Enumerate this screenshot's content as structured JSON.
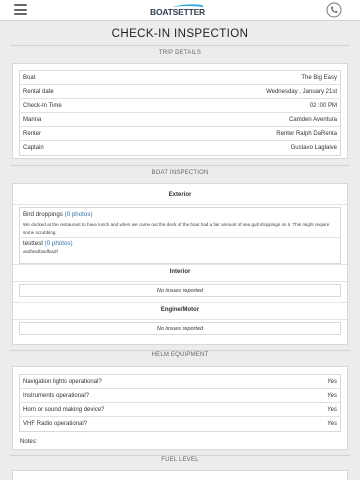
{
  "header": {
    "logo_text": "BOATSETTER",
    "menu_icon": "hamburger-menu-icon",
    "phone_icon": "phone-icon"
  },
  "page_title": "CHECK-IN INSPECTION",
  "trip_details": {
    "heading": "TRIP DETAILS",
    "rows": [
      {
        "label": "Boat",
        "value": "The Big Easy"
      },
      {
        "label": "Rental date",
        "value": "Wednesday , January 21st"
      },
      {
        "label": "Check-In Time",
        "value": "02 :00 PM"
      },
      {
        "label": "Marina",
        "value": "Camden Aventura"
      },
      {
        "label": "Renter",
        "value": "Renter Ralph DaRenta"
      },
      {
        "label": "Captain",
        "value": "Gustavo Laglaive"
      }
    ]
  },
  "boat_inspection": {
    "heading": "BOAT INSPECTION",
    "exterior": {
      "title": "Exterior",
      "items": [
        {
          "name": "Bird droppings",
          "photos": "(0 photos)",
          "description": "We docked at the restaurant to have lunch and when we came out the deck of the boat had a fair amount of sea gull droppings on it. This might require some scrubbing."
        },
        {
          "name": "testtest",
          "photos": "(0 photos)",
          "description": "asdfasdfasdfasdf"
        }
      ]
    },
    "interior": {
      "title": "Interior",
      "status": "No issues reported"
    },
    "engine": {
      "title": "Engine/Motor",
      "status": "No issues reported"
    }
  },
  "helm_equipment": {
    "heading": "HELM EQUIPMENT",
    "rows": [
      {
        "label": "Navigation lights operational?",
        "value": "Yes"
      },
      {
        "label": "Instruments operational?",
        "value": "Yes"
      },
      {
        "label": "Horn or sound making device?",
        "value": "Yes"
      },
      {
        "label": "VHF Radio operational?",
        "value": "Yes"
      }
    ],
    "notes_label": "Notes:"
  },
  "fuel_level": {
    "heading": "FUEL LEVEL"
  }
}
